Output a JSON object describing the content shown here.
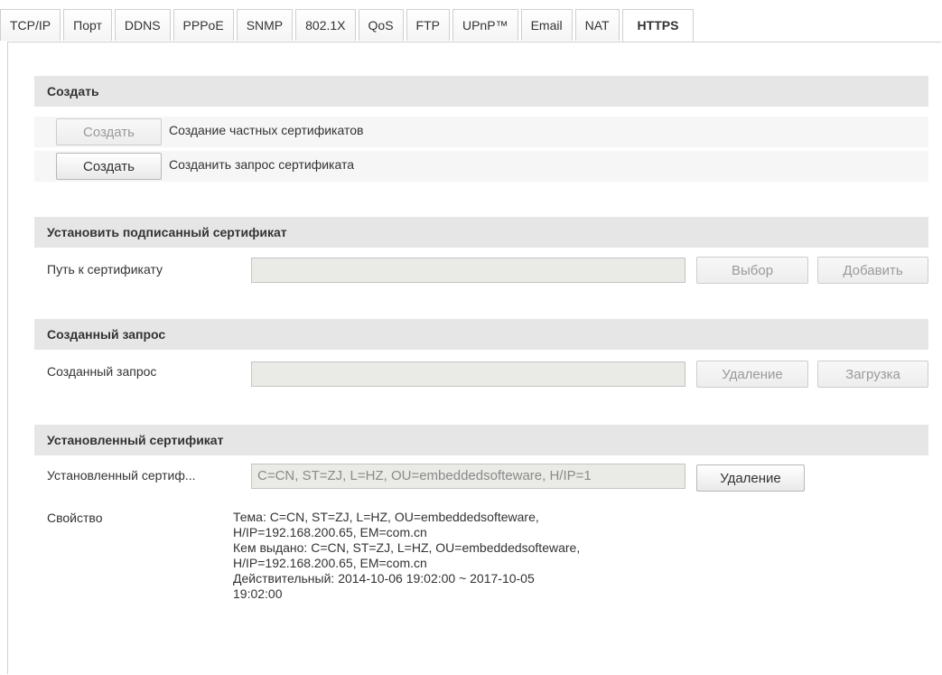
{
  "tabs": [
    "TCP/IP",
    "Порт",
    "DDNS",
    "PPPoE",
    "SNMP",
    "802.1X",
    "QoS",
    "FTP",
    "UPnP™",
    "Email",
    "NAT",
    "HTTPS"
  ],
  "active_tab": "HTTPS",
  "create": {
    "header": "Создать",
    "row1": {
      "button": "Создать",
      "text": "Создание частных сертификатов",
      "button_disabled": true
    },
    "row2": {
      "button": "Создать",
      "text": "Созданить запрос сертификата",
      "button_disabled": false
    }
  },
  "install_signed": {
    "header": "Установить подписанный сертификат",
    "label": "Путь к сертификату",
    "value": "",
    "browse": "Выбор",
    "add": "Добавить"
  },
  "created_request": {
    "header": "Созданный запрос",
    "label": "Созданный запрос",
    "value": "",
    "delete": "Удаление",
    "download": "Загрузка"
  },
  "installed_cert": {
    "header": "Установленный сертификат",
    "label": "Установленный сертиф...",
    "value": "C=CN, ST=ZJ, L=HZ, OU=embeddedsofteware, H/IP=1",
    "delete": "Удаление",
    "property_label": "Свойство",
    "property_lines": [
      "Тема: C=CN, ST=ZJ, L=HZ, OU=embeddedsofteware,",
      "H/IP=192.168.200.65, EM=com.cn",
      "Кем выдано: C=CN, ST=ZJ, L=HZ, OU=embeddedsofteware,",
      "H/IP=192.168.200.65, EM=com.cn",
      "Действительный: 2014-10-06 19:02:00 ~ 2017-10-05",
      "19:02:00"
    ]
  }
}
